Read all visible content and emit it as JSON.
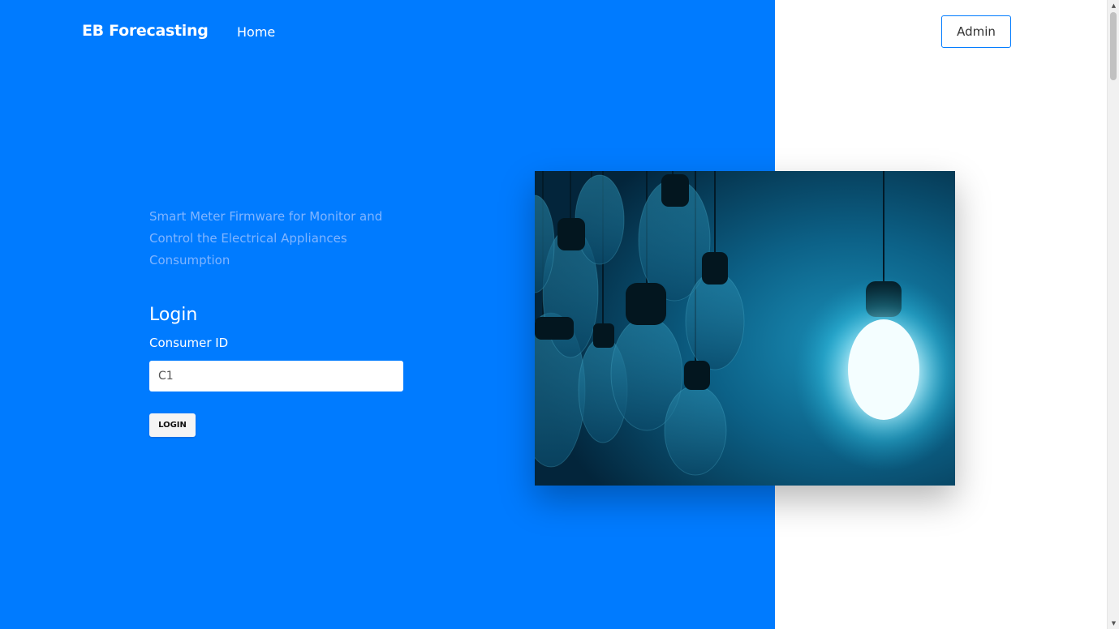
{
  "navbar": {
    "brand": "EB Forecasting",
    "links": [
      {
        "label": "Home"
      }
    ],
    "admin_label": "Admin"
  },
  "hero": {
    "tagline": "Smart Meter Firmware for Monitor and Control the Electrical Appliances Consumption",
    "image_description_icon": "light-bulbs-image"
  },
  "login": {
    "title": "Login",
    "consumer_id_label": "Consumer ID",
    "consumer_id_value": "C1",
    "button_label": "LOGIN"
  },
  "colors": {
    "primary_blue": "#007bff",
    "tagline": "#80b5ff",
    "white": "#ffffff"
  }
}
